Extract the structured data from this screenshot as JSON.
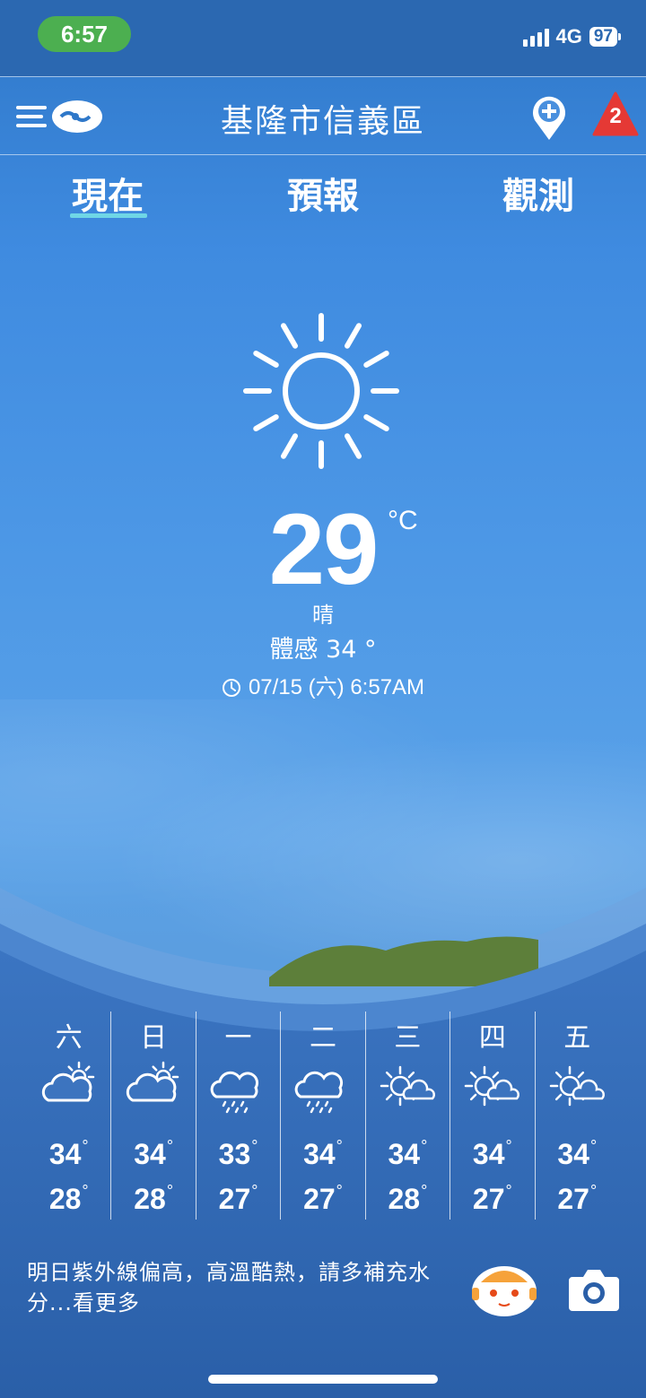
{
  "status_bar": {
    "time": "6:57",
    "network": "4G",
    "battery": "97"
  },
  "app_bar": {
    "location": "基隆市信義區",
    "alert_count": "2"
  },
  "tabs": [
    {
      "label": "現在"
    },
    {
      "label": "預報"
    },
    {
      "label": "觀測"
    }
  ],
  "current": {
    "icon": "sun-icon",
    "temperature": "29",
    "unit": "°C",
    "condition": "晴",
    "feels_like": "體感 34 °",
    "updated": "07/15 (六) 6:57AM"
  },
  "week": [
    {
      "day": "六",
      "icon": "partly-cloudy-icon",
      "high": "34",
      "low": "28"
    },
    {
      "day": "日",
      "icon": "partly-cloudy-icon",
      "high": "34",
      "low": "28"
    },
    {
      "day": "一",
      "icon": "rain-cloud-icon",
      "high": "33",
      "low": "27"
    },
    {
      "day": "二",
      "icon": "rain-cloud-icon",
      "high": "34",
      "low": "27"
    },
    {
      "day": "三",
      "icon": "sun-cloud-icon",
      "high": "34",
      "low": "28"
    },
    {
      "day": "四",
      "icon": "sun-cloud-icon",
      "high": "34",
      "low": "27"
    },
    {
      "day": "五",
      "icon": "sun-cloud-icon",
      "high": "34",
      "low": "27"
    }
  ],
  "degree_symbol": "°",
  "tip": "明日紫外線偏高，高溫酷熱，請多補充水分...看更多",
  "colors": {
    "accent_underline": "#6fd6e6",
    "alert_red": "#e53935",
    "status_time_bg": "#4caf50"
  }
}
